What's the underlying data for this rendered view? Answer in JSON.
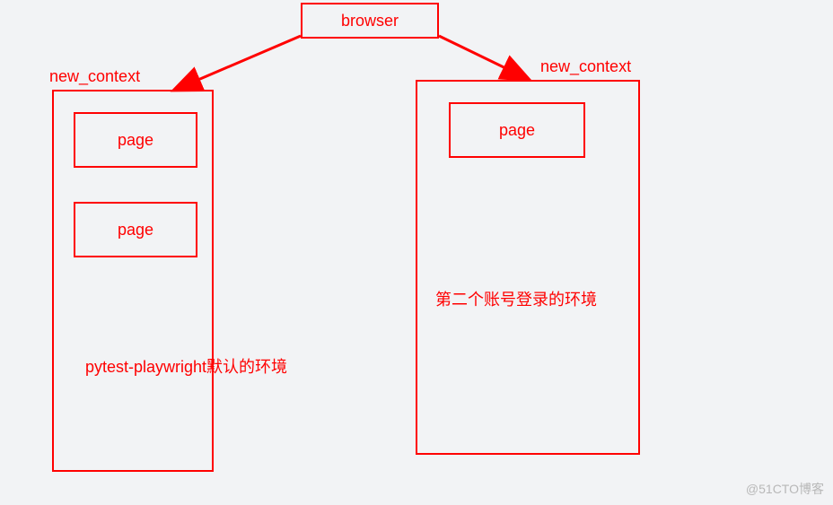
{
  "browser": {
    "label": "browser"
  },
  "contexts": {
    "left": {
      "label": "new_context",
      "pages": [
        "page",
        "page"
      ],
      "description": "pytest-playwright默认的环境"
    },
    "right": {
      "label": "new_context",
      "pages": [
        "page"
      ],
      "description": "第二个账号登录的环境"
    }
  },
  "watermark": "@51CTO博客",
  "colors": {
    "accent": "#ff0000",
    "background": "#f2f3f5"
  }
}
